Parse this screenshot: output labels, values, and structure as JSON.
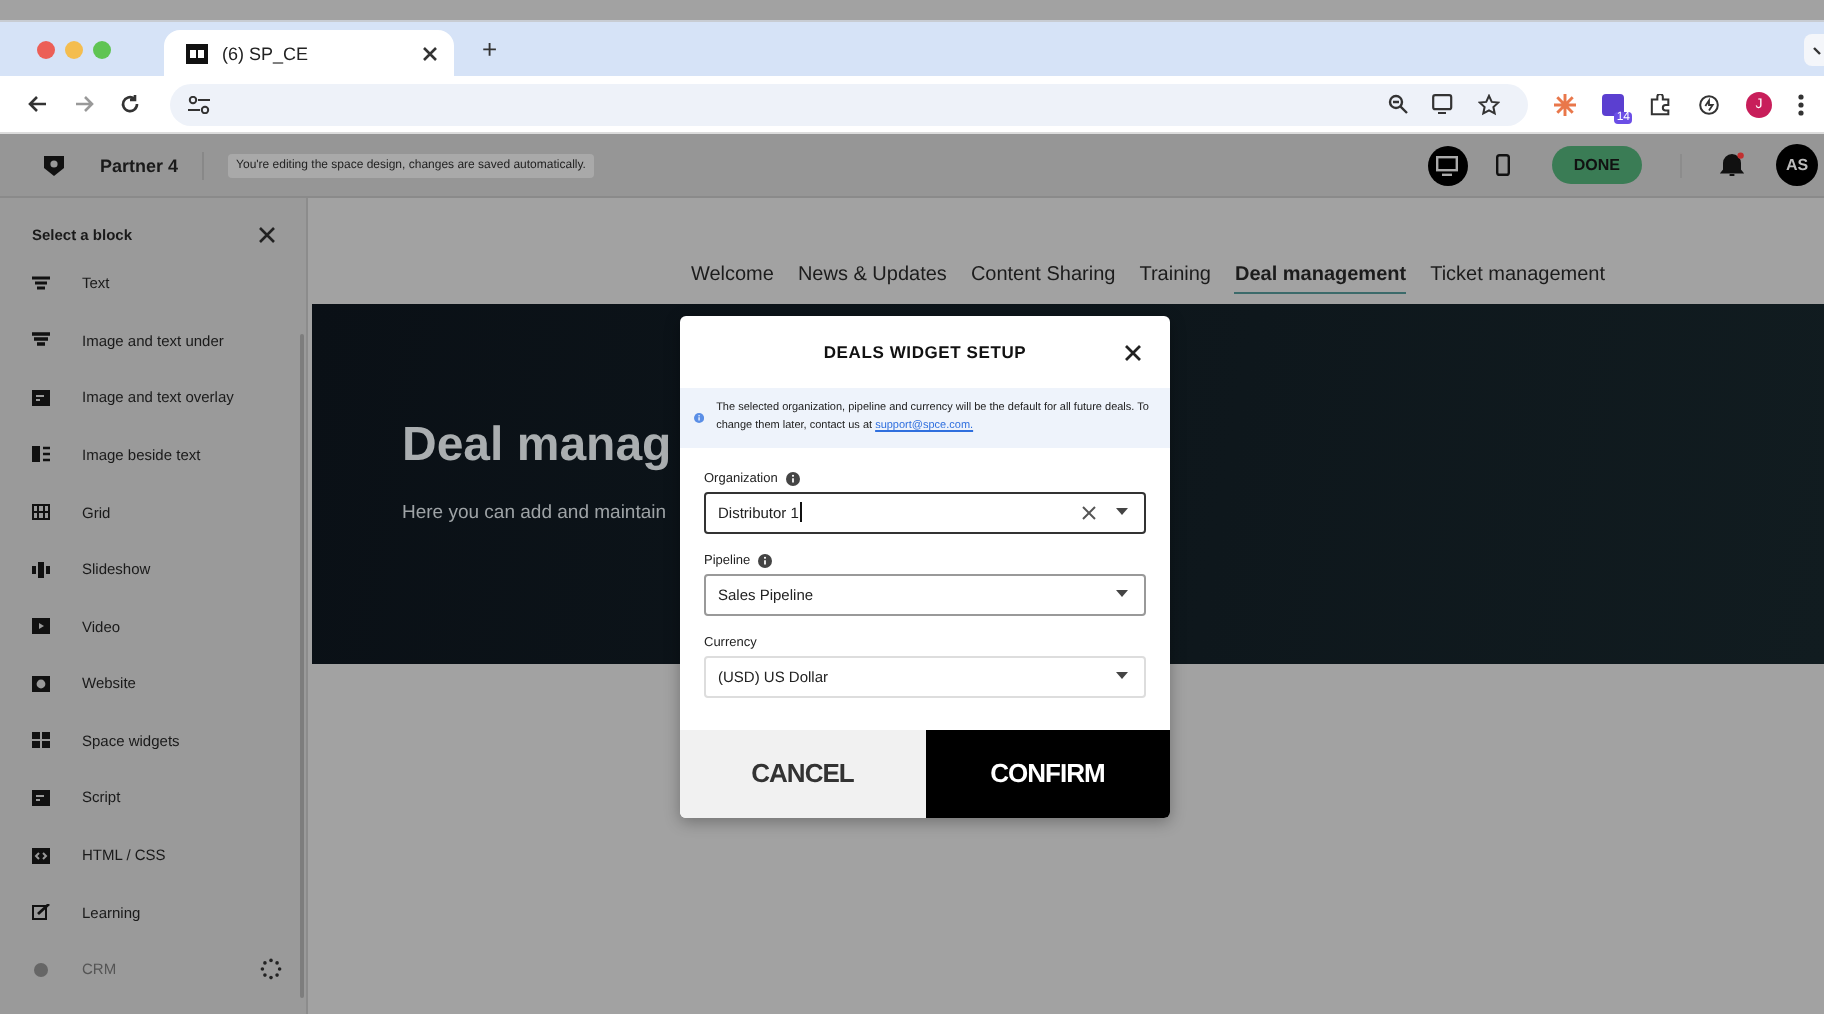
{
  "browser": {
    "tab_title": "(6) SP_CE",
    "new_tab": "+",
    "avatar": "J",
    "extension_badge": "14"
  },
  "app_header": {
    "workspace": "Partner 4",
    "notice": "You're editing the space design, changes are saved automatically.",
    "done_button": "DONE",
    "user_initials": "AS",
    "notification_dot": true,
    "view_modes": [
      {
        "kind": "desktop",
        "selected": true
      },
      {
        "kind": "mobile",
        "selected": false
      }
    ]
  },
  "sidebar": {
    "title": "Select a block",
    "items": [
      {
        "label": "Text",
        "disabled": false,
        "loading": false
      },
      {
        "label": "Image and text under",
        "disabled": false,
        "loading": false
      },
      {
        "label": "Image and text overlay",
        "disabled": false,
        "loading": false
      },
      {
        "label": "Image beside text",
        "disabled": false,
        "loading": false
      },
      {
        "label": "Grid",
        "disabled": false,
        "loading": false
      },
      {
        "label": "Slideshow",
        "disabled": false,
        "loading": false
      },
      {
        "label": "Video",
        "disabled": false,
        "loading": false
      },
      {
        "label": "Website",
        "disabled": false,
        "loading": false
      },
      {
        "label": "Space widgets",
        "disabled": false,
        "loading": false
      },
      {
        "label": "Script",
        "disabled": false,
        "loading": false
      },
      {
        "label": "HTML / CSS",
        "disabled": false,
        "loading": false
      },
      {
        "label": "Learning",
        "disabled": false,
        "loading": false
      },
      {
        "label": "CRM",
        "disabled": true,
        "loading": true
      }
    ]
  },
  "nav_tabs": [
    {
      "label": "Welcome",
      "selected": false
    },
    {
      "label": "News & Updates",
      "selected": false
    },
    {
      "label": "Content Sharing",
      "selected": false
    },
    {
      "label": "Training",
      "selected": false
    },
    {
      "label": "Deal management",
      "selected": true
    },
    {
      "label": "Ticket management",
      "selected": false
    }
  ],
  "hero": {
    "title": "Deal manag",
    "subtitle": "Here you can add and maintain"
  },
  "dialog": {
    "title": "DEALS WIDGET SETUP",
    "info_text": "The selected organization, pipeline and currency will be the default for all future deals. To change them later, contact us at",
    "info_link": "support@spce.com.",
    "fields": [
      {
        "label": "Organization",
        "info_icon": true,
        "value": "Distributor 1",
        "focused": true,
        "clearable": true
      },
      {
        "label": "Pipeline",
        "info_icon": true,
        "value": "Sales Pipeline",
        "focused": false,
        "clearable": false
      },
      {
        "label": "Currency",
        "info_icon": false,
        "value": "(USD) US Dollar",
        "focused": false,
        "clearable": false
      }
    ],
    "cancel_button": "CANCEL",
    "confirm_button": "CONFIRM"
  }
}
